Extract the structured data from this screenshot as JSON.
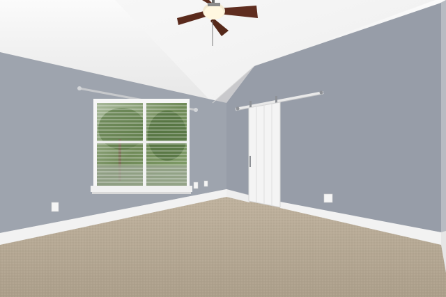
{
  "scene": {
    "description_visible_text": "",
    "colors": {
      "ceiling": "#efefef",
      "wall_left": "#9da3ad",
      "wall_right": "#969ca7",
      "baseboard": "#f2f2f2",
      "carpet": "#b7aa96",
      "door": "#f4f4f4",
      "fan_blade": "#5a2a1c",
      "window_frame": "#f7f7f7",
      "tree_green": "#6e8a55"
    },
    "icons": [
      "ceiling-fan-icon",
      "barn-door-icon",
      "window-icon",
      "outlet-icon"
    ]
  }
}
